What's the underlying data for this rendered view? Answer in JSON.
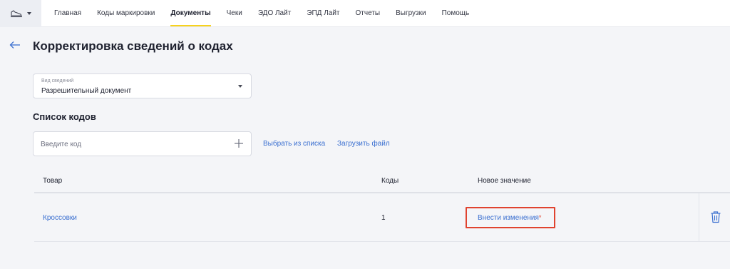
{
  "nav": {
    "items": [
      "Главная",
      "Коды маркировки",
      "Документы",
      "Чеки",
      "ЭДО Лайт",
      "ЭПД Лайт",
      "Отчеты",
      "Выгрузки",
      "Помощь"
    ],
    "active": "Документы",
    "accent_color": "#f7d21d"
  },
  "header": {
    "title": "Корректировка сведений о кодах"
  },
  "info_type": {
    "label": "Вид сведений",
    "value": "Разрешительный документ"
  },
  "codes": {
    "section_title": "Список кодов",
    "input_placeholder": "Введите код",
    "choose_from_list": "Выбрать из списка",
    "upload_file": "Загрузить файл"
  },
  "table": {
    "columns": [
      "Товар",
      "Коды",
      "Новое значение"
    ],
    "rows": [
      {
        "product": "Кроссовки",
        "codes": "1",
        "action": "Внести изменения",
        "required_mark": "*"
      }
    ]
  },
  "colors": {
    "link": "#3a6fd0",
    "highlight": "#e0432f"
  }
}
